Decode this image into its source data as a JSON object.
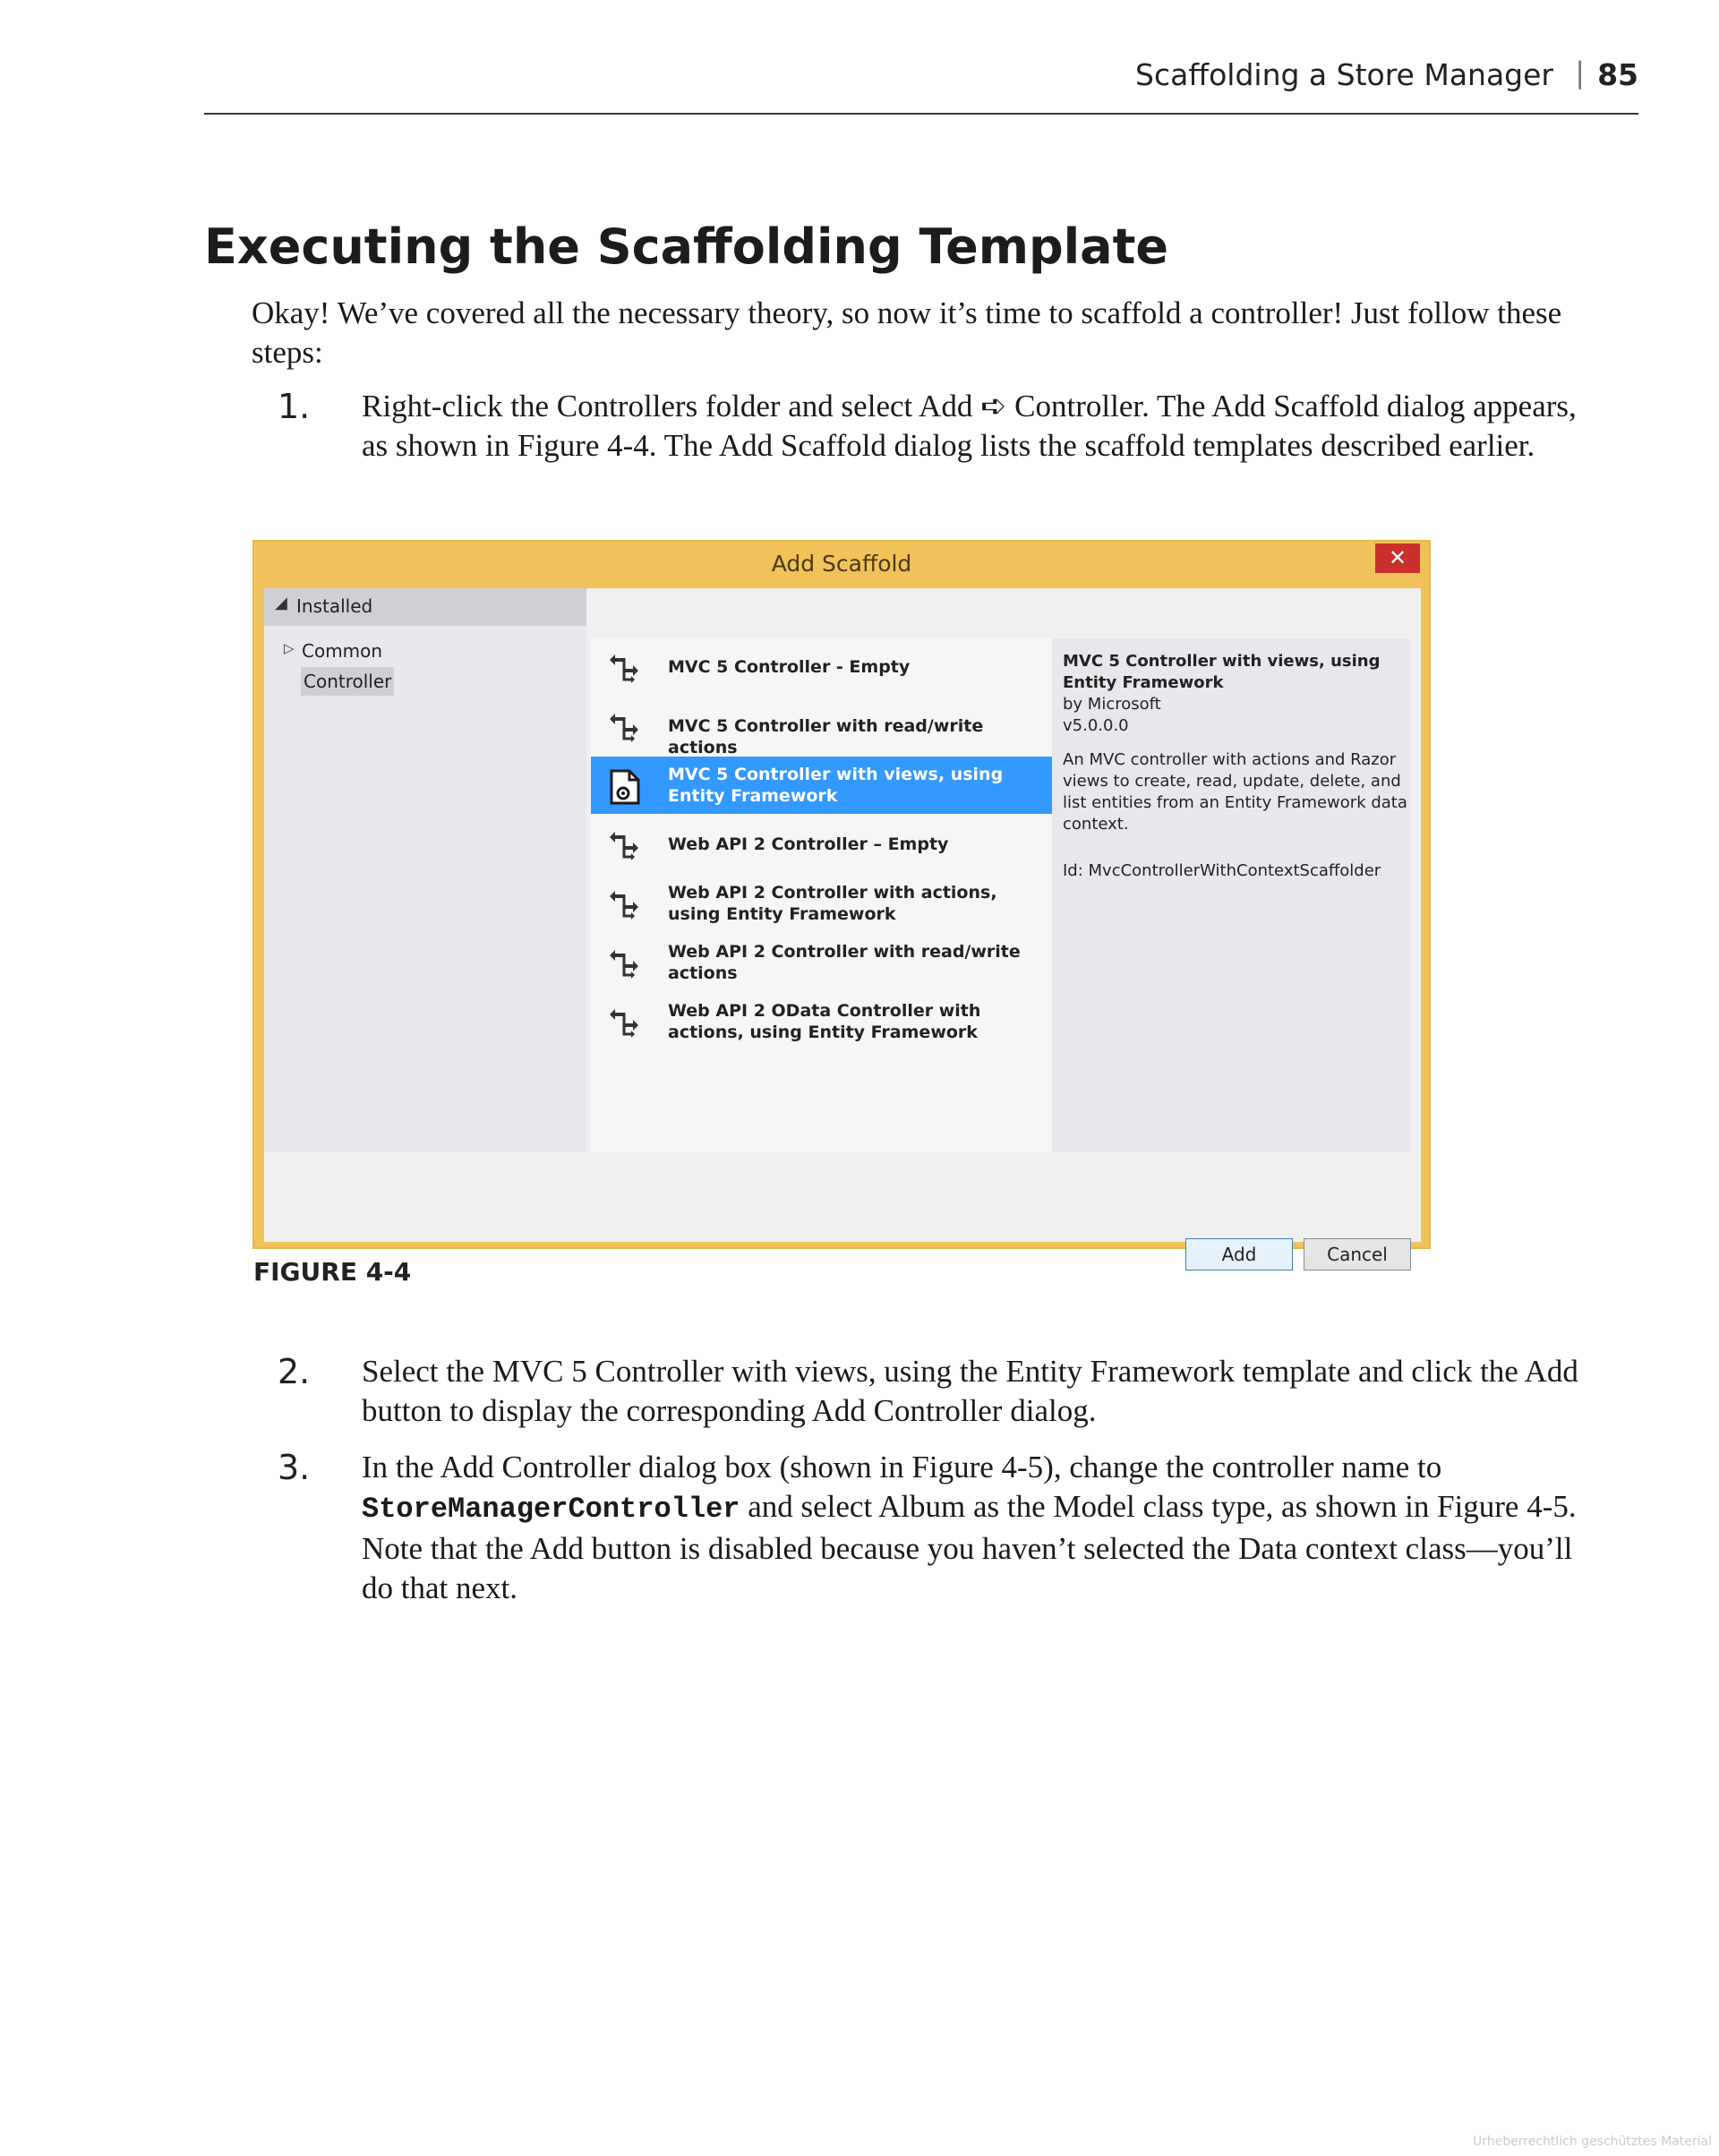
{
  "running_header": {
    "title": "Scaffolding a Store Manager",
    "separator": "|",
    "page_number": "85"
  },
  "section_title": "Executing the Scaffolding Template",
  "intro": "Okay! We’ve covered all the necessary theory, so now it’s time to scaffold a controller! Just follow these steps:",
  "steps": [
    {
      "num": "1.",
      "text": "Right-click the Controllers folder and select Add ➪ Controller. The Add Scaffold dialog appears, as shown in Figure 4-4. The Add Scaffold dialog lists the scaffold templates described earlier."
    },
    {
      "num": "2.",
      "text": "Select the MVC 5 Controller with views, using the Entity Framework template and click the Add button to display the corresponding Add Controller dialog."
    },
    {
      "num": "3.",
      "text_before": "In the Add Controller dialog box (shown in Figure 4-5), change the controller name to ",
      "code": "StoreManagerController",
      "text_after": " and select Album as the Model class type, as shown in Figure 4-5. Note that the Add button is disabled because you haven’t selected the Data context class—you’ll do that next."
    }
  ],
  "dialog": {
    "title": "Add Scaffold",
    "close_glyph": "✕",
    "tree": {
      "installed": "Installed",
      "common": "Common",
      "controller": "Controller"
    },
    "templates": [
      "MVC 5 Controller - Empty",
      "MVC 5 Controller with read/write actions",
      "MVC 5 Controller with views, using Entity Framework",
      "Web API 2 Controller – Empty",
      "Web API 2 Controller with actions, using Entity Framework",
      "Web API 2 Controller with read/write actions",
      "Web API 2 OData Controller with actions, using Entity Framework"
    ],
    "selected_index": 2,
    "details": {
      "title": "MVC 5 Controller with views, using Entity Framework",
      "author": "by Microsoft",
      "version": "v5.0.0.0",
      "description": "An MVC controller with actions and Razor views to create, read, update, delete, and list entities from an Entity Framework data context.",
      "id": "Id: MvcControllerWithContextScaffolder"
    },
    "buttons": {
      "add": "Add",
      "cancel": "Cancel"
    },
    "icons": {
      "template": "scaffold-controller-icon",
      "selected": "document-gear-icon"
    },
    "colors": {
      "title_bar": "#f0c35a",
      "selection": "#3399ff",
      "close": "#c9302c"
    }
  },
  "figure_caption": "FIGURE 4-4",
  "watermark": "Urheberrechtlich geschütztes Material"
}
